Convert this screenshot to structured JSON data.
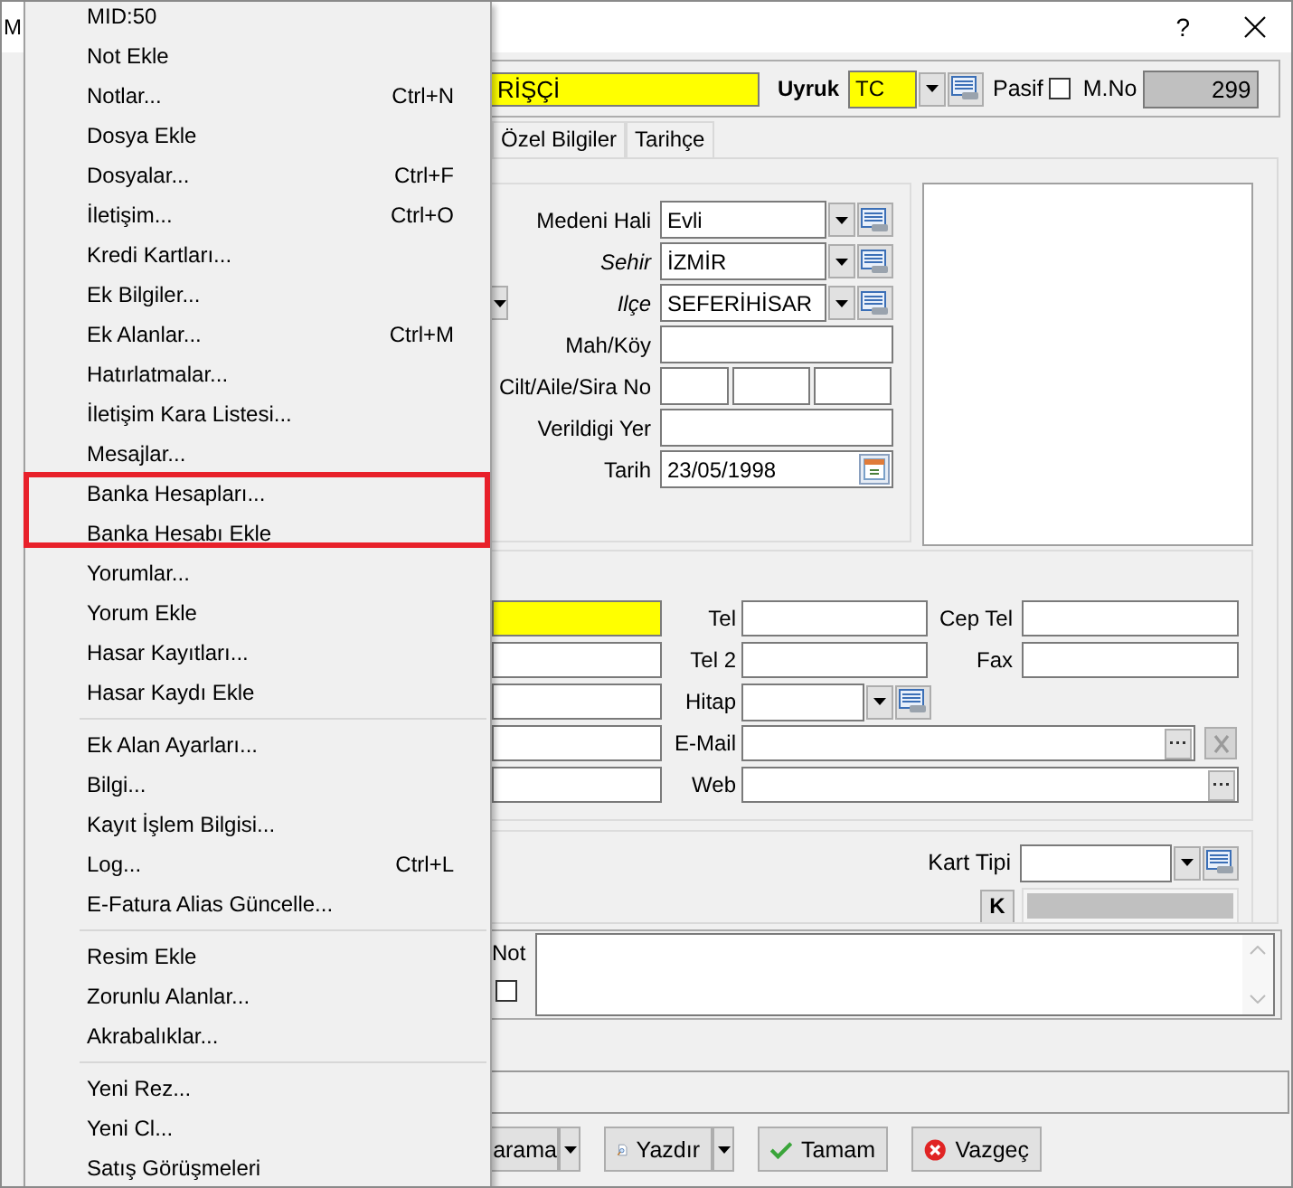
{
  "window": {
    "title": "M",
    "help": "?"
  },
  "menu": {
    "items": [
      {
        "kind": "item",
        "label": "MID:50",
        "highlighted": false
      },
      {
        "kind": "item",
        "label": "Not Ekle",
        "highlighted": false
      },
      {
        "kind": "item",
        "label": "Notlar...",
        "shortcut": "Ctrl+N",
        "highlighted": false
      },
      {
        "kind": "item",
        "label": "Dosya Ekle",
        "highlighted": false
      },
      {
        "kind": "item",
        "label": "Dosyalar...",
        "shortcut": "Ctrl+F",
        "highlighted": false
      },
      {
        "kind": "item",
        "label": "İletişim...",
        "shortcut": "Ctrl+O",
        "highlighted": false
      },
      {
        "kind": "item",
        "label": "Kredi Kartları...",
        "highlighted": false
      },
      {
        "kind": "item",
        "label": "Ek Bilgiler...",
        "highlighted": false
      },
      {
        "kind": "item",
        "label": "Ek Alanlar...",
        "shortcut": "Ctrl+M",
        "highlighted": false
      },
      {
        "kind": "item",
        "label": "Hatırlatmalar...",
        "highlighted": false
      },
      {
        "kind": "item",
        "label": "İletişim Kara Listesi...",
        "highlighted": false
      },
      {
        "kind": "item",
        "label": "Mesajlar...",
        "highlighted": false
      },
      {
        "kind": "item",
        "label": "Banka Hesapları...",
        "highlighted": true
      },
      {
        "kind": "item",
        "label": "Banka Hesabı Ekle",
        "highlighted": true
      },
      {
        "kind": "item",
        "label": "Yorumlar...",
        "highlighted": false
      },
      {
        "kind": "item",
        "label": "Yorum Ekle",
        "highlighted": false
      },
      {
        "kind": "item",
        "label": "Hasar Kayıtları...",
        "highlighted": false
      },
      {
        "kind": "item",
        "label": "Hasar Kaydı Ekle",
        "highlighted": false
      },
      {
        "kind": "separator"
      },
      {
        "kind": "item",
        "label": "Ek Alan Ayarları...",
        "highlighted": false
      },
      {
        "kind": "item",
        "label": "Bilgi...",
        "highlighted": false
      },
      {
        "kind": "item",
        "label": "Kayıt İşlem Bilgisi...",
        "highlighted": false
      },
      {
        "kind": "item",
        "label": "Log...",
        "shortcut": "Ctrl+L",
        "highlighted": false
      },
      {
        "kind": "item",
        "label": "E-Fatura Alias Güncelle...",
        "highlighted": false
      },
      {
        "kind": "separator"
      },
      {
        "kind": "item",
        "label": "Resim Ekle",
        "highlighted": false
      },
      {
        "kind": "item",
        "label": "Zorunlu Alanlar...",
        "highlighted": false
      },
      {
        "kind": "item",
        "label": "Akrabalıklar...",
        "highlighted": false
      },
      {
        "kind": "separator"
      },
      {
        "kind": "item",
        "label": "Yeni Rez...",
        "highlighted": false
      },
      {
        "kind": "item",
        "label": "Yeni Cl...",
        "highlighted": false
      },
      {
        "kind": "item",
        "label": "Satış Görüşmeleri",
        "highlighted": false
      }
    ]
  },
  "header": {
    "name_value": "RİŞÇİ",
    "nationality_label": "Uyruk",
    "nationality_value": "TC",
    "passive_label": "Pasif",
    "passive_checked": false,
    "number_label": "M.No",
    "number_value": "299"
  },
  "tabs": [
    {
      "label": "Özel Bilgiler",
      "selected": false
    },
    {
      "label": "Tarihçe",
      "selected": false
    }
  ],
  "personal": {
    "rows": [
      {
        "kind": "combo",
        "label": "Medeni Hali",
        "italic": false,
        "value": "Evli"
      },
      {
        "kind": "combo",
        "label": "Sehir",
        "italic": true,
        "value": "İZMİR"
      },
      {
        "kind": "combo",
        "label": "Ilçe",
        "italic": true,
        "value": "SEFERİHİSAR",
        "partial_combo": true
      },
      {
        "kind": "text",
        "label": "Mah/Köy",
        "italic": false
      },
      {
        "kind": "triple",
        "label": "Cilt/Aile/Sira No",
        "italic": false
      },
      {
        "kind": "text",
        "label": "Verildigi Yer",
        "italic": false
      },
      {
        "kind": "date",
        "label": "Tarih",
        "italic": false,
        "value": "23/05/1998"
      }
    ]
  },
  "contact": {
    "rows": [
      {
        "kind": "text",
        "required": true,
        "label": "Tel",
        "label2": "Cep Tel"
      },
      {
        "kind": "text",
        "required": false,
        "label": "Tel 2",
        "label2": "Fax"
      },
      {
        "kind": "combo",
        "required": false,
        "label": "Hitap"
      },
      {
        "kind": "email",
        "required": false,
        "label": "E-Mail",
        "clear_disabled": true
      },
      {
        "kind": "web",
        "required": false,
        "label": "Web"
      }
    ]
  },
  "card": {
    "type_label": "Kart Tipi",
    "key_button": "K"
  },
  "note": {
    "label": "Not",
    "checked": false
  },
  "buttons": [
    {
      "kind": "search-split",
      "label": "arama"
    },
    {
      "kind": "print-split",
      "label": "Yazdır"
    },
    {
      "kind": "ok",
      "label": "Tamam"
    },
    {
      "kind": "cancel",
      "label": "Vazgeç"
    }
  ]
}
